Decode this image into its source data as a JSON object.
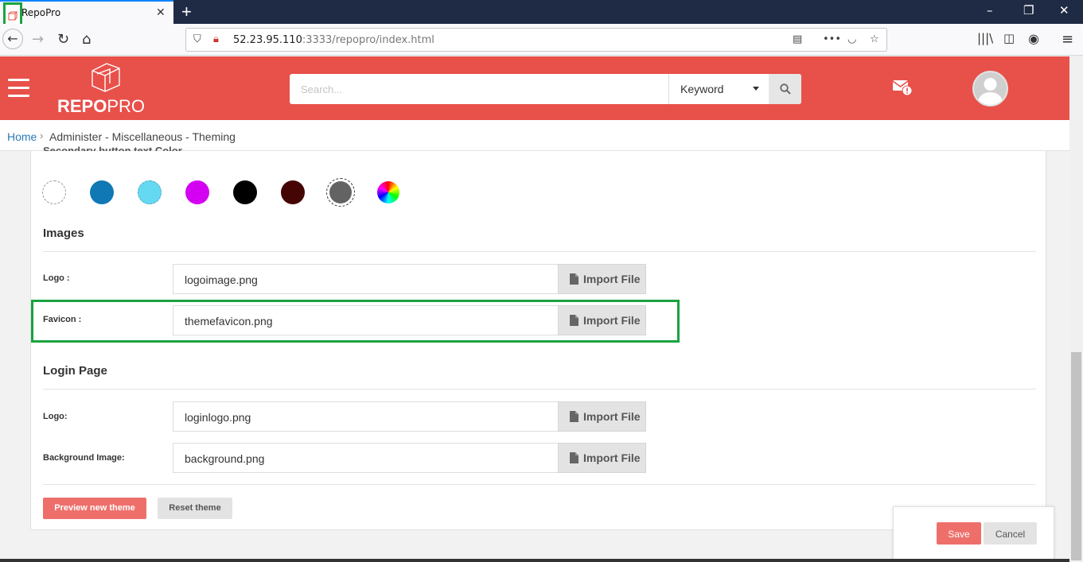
{
  "browser": {
    "tab_title": "RepoPro",
    "url_host": "52.23.95.110",
    "url_path": ":3333/repopro/index.html"
  },
  "header": {
    "logo_text_bold": "REPO",
    "logo_text_light": "PRO",
    "search_placeholder": "Search...",
    "search_type": "Keyword"
  },
  "breadcrumb": {
    "home": "Home",
    "separator": "›",
    "current": "Administer - Miscellaneous - Theming"
  },
  "theming": {
    "cut_section_label": "Secondary button text Color",
    "swatches": [
      {
        "name": "white",
        "color": "#ffffff"
      },
      {
        "name": "blue",
        "color": "#1078b4"
      },
      {
        "name": "light-blue",
        "color": "#66d9f2"
      },
      {
        "name": "magenta",
        "color": "#d400f2"
      },
      {
        "name": "black",
        "color": "#000000"
      },
      {
        "name": "maroon",
        "color": "#450505"
      },
      {
        "name": "gray",
        "color": "#636363"
      }
    ],
    "images_title": "Images",
    "logo_label": "Logo :",
    "logo_file": "logoimage.png",
    "favicon_label": "Favicon :",
    "favicon_file": "themefavicon.png",
    "login_title": "Login Page",
    "login_logo_label": "Logo:",
    "login_logo_file": "loginlogo.png",
    "background_label": "Background Image:",
    "background_file": "background.png",
    "import_label": "Import File",
    "preview_button": "Preview new theme",
    "reset_button": "Reset theme"
  },
  "save_panel": {
    "save": "Save",
    "cancel": "Cancel"
  },
  "colors": {
    "brand": "#e8504a",
    "button_primary": "#ee6f6a",
    "highlight": "#1aa340",
    "link": "#2a7ab8"
  }
}
